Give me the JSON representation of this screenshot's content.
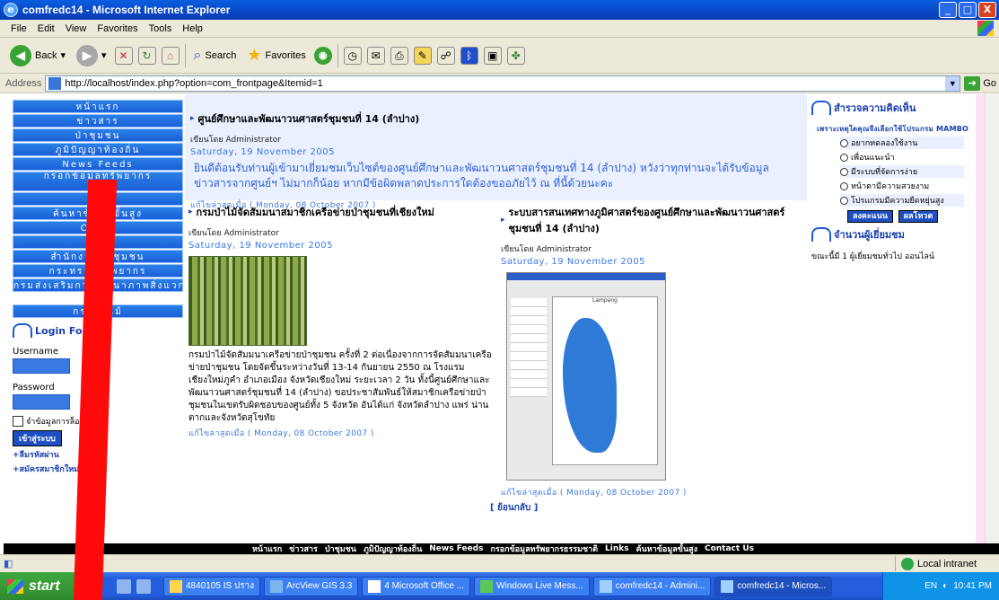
{
  "window": {
    "title": "comfredc14 - Microsoft Internet Explorer",
    "buttons": [
      "_",
      "□",
      "X"
    ]
  },
  "menu": [
    "File",
    "Edit",
    "View",
    "Favorites",
    "Tools",
    "Help"
  ],
  "toolbar": {
    "back_label": "Back",
    "search_label": "Search",
    "favorites_label": "Favorites"
  },
  "address": {
    "label": "Address",
    "url": "http://localhost/index.php?option=com_frontpage&Itemid=1",
    "go_label": "Go"
  },
  "leftnav": {
    "items": [
      "หน้าแรก",
      "ข่าวสาร",
      "ป่าชุมชน",
      "ภูมิปัญญาท้องถิ่น",
      "News Feeds",
      "กรอกข้อมูลทรัพยากร",
      "s",
      "ค้นหาข้อมูลขั้นสูง",
      "Co  Us",
      "ไม้",
      "สำนักงานป่าชุมชน",
      "กระทรวงทรัพยากร",
      "กรมส่งเสริมการพัฒนาภาพสิ่งแวก",
      "กรมป่าไม้"
    ]
  },
  "login": {
    "title": "Login For",
    "username_label": "Username",
    "password_label": "Password",
    "remember_label": "จำข้อมูลการล็อ",
    "button_label": "เข้าสู่ระบบ",
    "lost_password": "+ลืมรหัสผ่าน",
    "register": "+สมัครสมาชิกใหม่"
  },
  "feature": {
    "title": "ศูนย์ศึกษาและพัฒนาวนศาสตร์ชุมชนที่ 14 (ลำปาง)",
    "author": "เขียนโดย Administrator",
    "date": "Saturday, 19 November 2005",
    "intro": "ยินดีต้อนรับท่านผู้เข้ามาเยี่ยมชมเว็บไซต์ของศูนย์ศึกษาและพัฒนาวนศาสตร์ชุมชนที่ 14 (ลำปาง) หวังว่าทุกท่านจะได้รับข้อมูลข่าวสารจากศูนย์ฯ ไม่มากก็น้อย หากมีข้อผิดพลาดประการใดต้องขออภัยไว้ ณ ที่นี้ด้วยนะคะ",
    "modified": "แก้ไขล่าสุดเมื่อ ( Monday, 08 October 2007 )"
  },
  "article1": {
    "title": "กรมป่าไม้จัดสัมมนาสมาชิกเครือข่ายป่าชุมชนที่เชียงใหม่",
    "author": "เขียนโดย Administrator",
    "date": "Saturday, 19 November 2005",
    "body": "กรมป่าไม้จัดสัมมนาเครือข่ายป่าชุมชน ครั้งที่ 2 ต่อเนื่องจากการจัดสัมมนาเครือข่ายป่าชุมชน โดยจัดขึ้นระหว่างวันที่ 13-14 กันยายน 2550 ณ โรงแรมเชียงใหม่ภูคำ อำเภอเมือง จังหวัดเชียงใหม่ ระยะเวลา 2 วัน ทั้งนี้ศูนย์ศึกษาและพัฒนาวนศาสตร์ชุมชนที่ 14 (ลำปาง) ขอประชาสัมพันธ์ให้สมาชิกเครือข่ายป่าชุมชนในเขตรับผิดชอบของศูนย์ทั้ง 5 จังหวัด อันได้แก่ จังหวัดลำปาง แพร่ น่าน ตากและจังหวัดสุโขทัย",
    "modified": "แก้ไขล่าสุดเมื่อ ( Monday, 08 October 2007 )"
  },
  "article2": {
    "title": "ระบบสารสนเทศทางภูมิศาสตร์ของศูนย์ศึกษาและพัฒนาวนศาสตร์ชุมชนที่ 14 (ลำปาง)",
    "author": "เขียนโดย Administrator",
    "date": "Saturday, 19 November 2005",
    "map_title": "Lampang",
    "modified": "แก้ไขล่าสุดเมื่อ ( Monday, 08 October 2007 )",
    "back": "[ ย้อนกลับ ]"
  },
  "poll": {
    "title": "สำรวจความคิดเห็น",
    "question": "เพราะเหตุใดคุณจึงเลือกใช้โปรแกรม MAMBO",
    "options": [
      "อยากทดลองใช้งาน",
      "เพื่อนแนะนำ",
      "มีระบบที่จัดการง่าย",
      "หน้าตามีความสวยงาม",
      "โปรแกรมมีความยืดหยุ่นสูง"
    ],
    "vote_label": "ลงคะแนน",
    "results_label": "ผลโหวต"
  },
  "visitors": {
    "title": "จำนวนผู้เยี่ยมชม",
    "text": "ขณะนี้มี 1 ผู้เยี่ยมชมทั่วไป ออนไลน์"
  },
  "footer_nav": [
    "หน้าแรก",
    "ข่าวสาร",
    "ป่าชุมชน",
    "ภูมิปัญญาท้องถิ่น",
    "News Feeds",
    "กรอกข้อมูลทรัพยากรธรรมชาติ",
    "Links",
    "ค้นหาข้อมูลขั้นสูง",
    "Contact Us"
  ],
  "status": {
    "zone": "Local intranet"
  },
  "taskbar": {
    "start": "start",
    "tasks": [
      "4840105 IS ปราง",
      "ArcView GIS 3.3",
      "4 Microsoft Office ...",
      "Windows Live Mess...",
      "comfredc14 - Admini...",
      "comfredc14 - Micros..."
    ],
    "lang": "EN",
    "clock": "10:41 PM"
  }
}
